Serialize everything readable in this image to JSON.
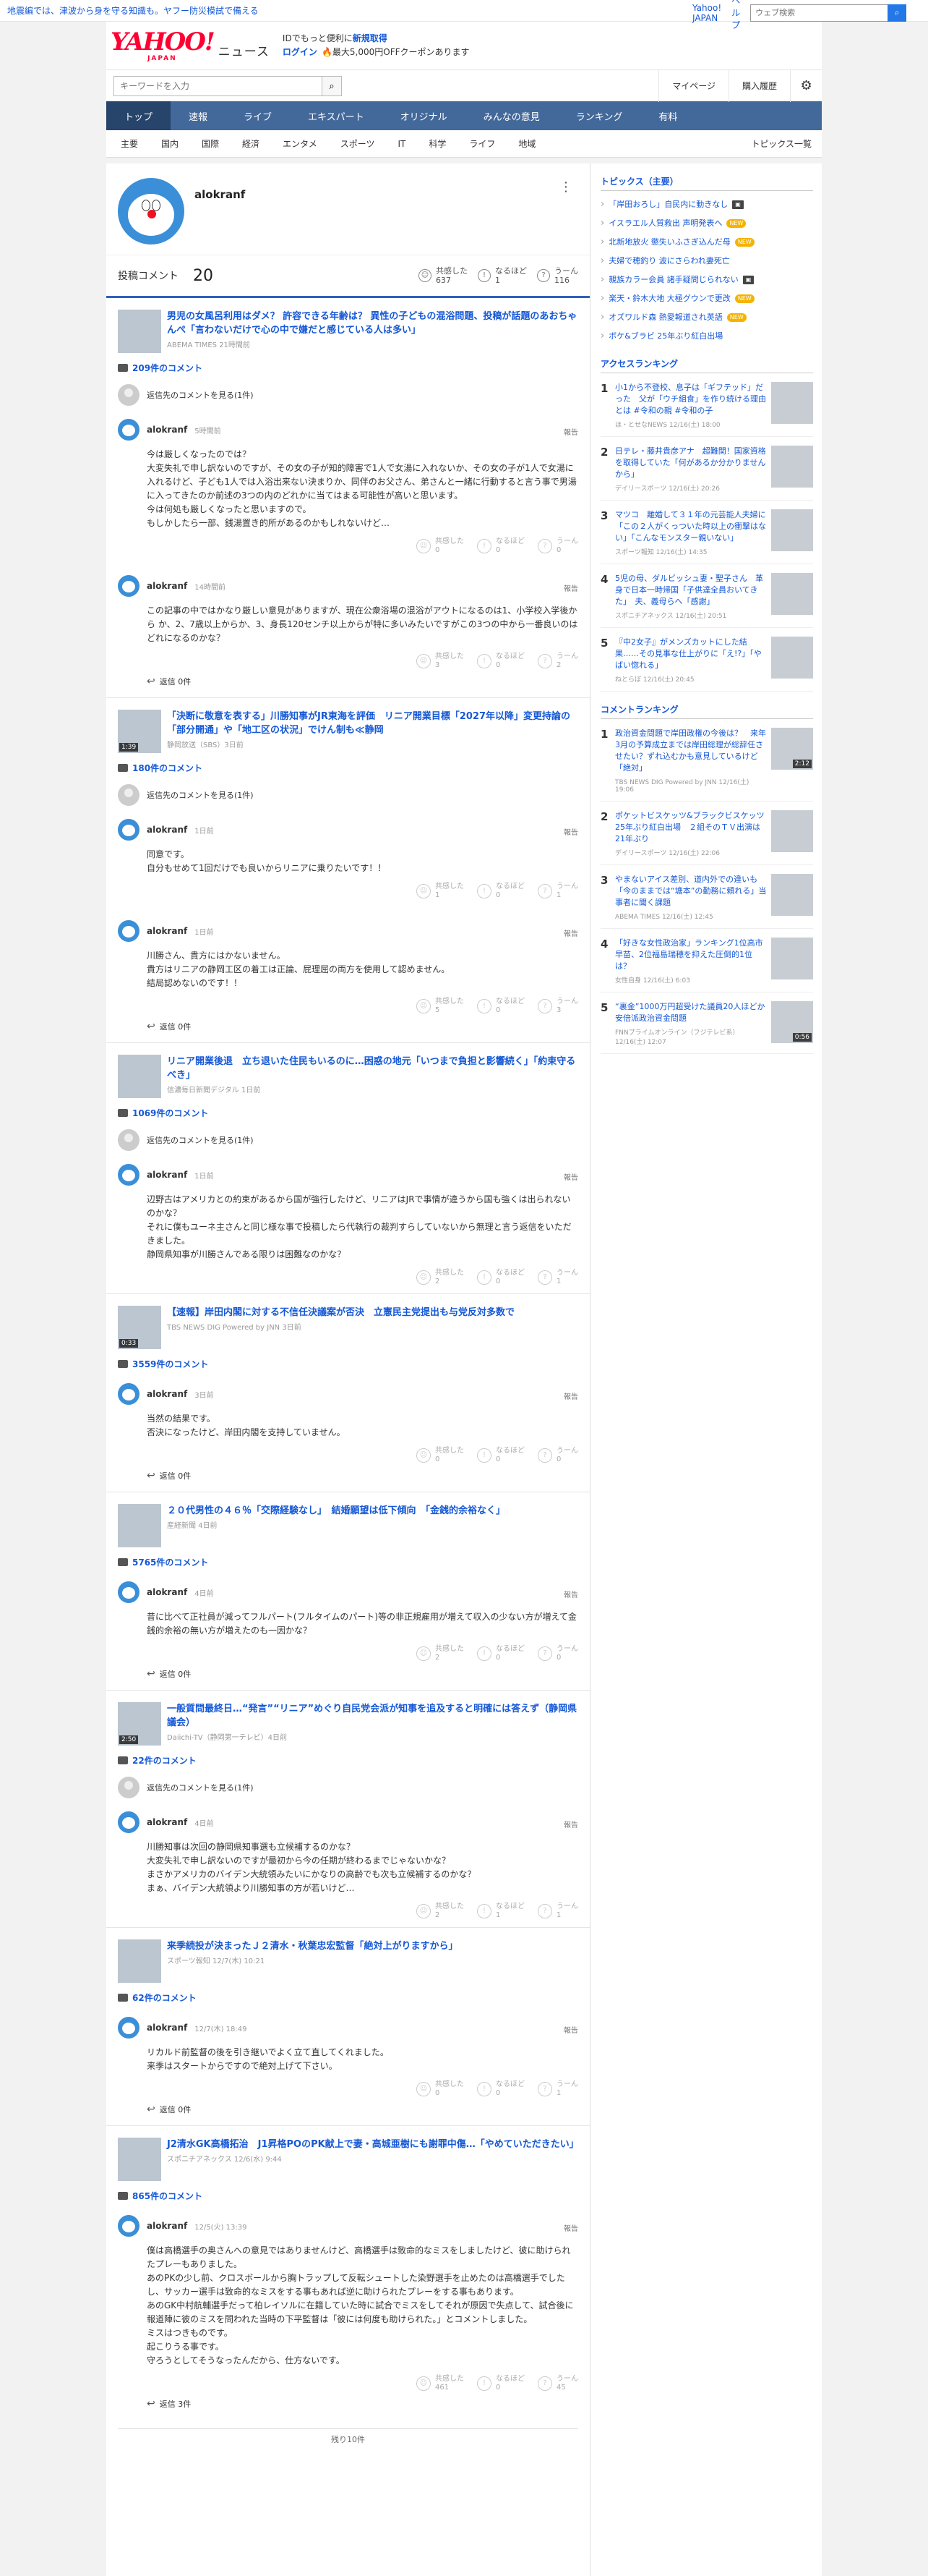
{
  "banner": {
    "message": "地震編では、津波から身を守る知識も。ヤフー防災模試で備える",
    "links": [
      "Yahoo! JAPAN",
      "ヘルプ"
    ],
    "search_placeholder": "ウェブ検索"
  },
  "header": {
    "logo_main": "YAHOO!",
    "logo_sub": "JAPAN",
    "logo_news": "ニュース",
    "promo_line1_prefix": "IDでもっと便利に",
    "promo_line1_link": "新規取得",
    "promo_login": "ログイン",
    "promo_coupon": "最大5,000円OFFクーポンあります"
  },
  "search_row": {
    "placeholder": "キーワードを入力",
    "links": [
      "マイページ",
      "購入履歴"
    ]
  },
  "main_nav": [
    "トップ",
    "速報",
    "ライブ",
    "エキスパート",
    "オリジナル",
    "みんなの意見",
    "ランキング",
    "有料"
  ],
  "sub_nav": [
    "主要",
    "国内",
    "国際",
    "経済",
    "エンタメ",
    "スポーツ",
    "IT",
    "科学",
    "ライフ",
    "地域"
  ],
  "sub_nav_right": "トピックス一覧",
  "profile": {
    "name": "alokranf",
    "comment_label": "投稿コメント",
    "comment_count": "20",
    "reactions": [
      {
        "label": "共感した",
        "value": "637"
      },
      {
        "label": "なるほど",
        "value": "1"
      },
      {
        "label": "うーん",
        "value": "116"
      }
    ]
  },
  "articles": [
    {
      "title": "男児の女風呂利用はダメ？ 許容できる年齢は？ 異性の子どもの混浴問題、投稿が話題のあおちゃんぺ「言わないだけで心の中で嫌だと感じている人は多い」",
      "source": "ABEMA TIMES 21時間前",
      "comment_count": "209件のコメント",
      "deleted": "返信先のコメントを見る(1件)",
      "comments": [
        {
          "user": "alokranf",
          "time": "5時間前",
          "body": "今は厳しくなったのでは？\n大変失礼で申し訳ないのですが、その女の子が知的障害で1人で女湯に入れないか、その女の子が1人で女湯に入れるけど、子ども1人では入浴出来ない決まりか、同伴のお父さん、弟さんと一緒に行動すると言う事で男湯に入ってきたのか前述の3つの内のどれかに当てはまる可能性が高いと思います。\n今は何処も厳しくなったと思いますので。\nもしかしたら一部、銭湯置き的所があるのかもしれないけど…",
          "r1": "0",
          "r2": "0",
          "r3": "0",
          "reply": ""
        },
        {
          "user": "alokranf",
          "time": "14時間前",
          "body": "この記事の中ではかなり厳しい意見がありますが、現在公衆浴場の混浴がアウトになるのは1、小学校入学後から か、2、7歳以上からか、3、身長120センチ以上からが特に多いみたいですがこの3つの中から一番良いのはどれになるのかな？",
          "r1": "3",
          "r2": "0",
          "r3": "2",
          "reply": "返信 0件"
        }
      ]
    },
    {
      "title": "「決断に敬意を表する」川勝知事がJR東海を評価　リニア開業目標「2027年以降」変更持論の「部分開通」や「地工区の状況」でけん制も≪静岡",
      "source": "静岡放送（SBS）3日前",
      "comment_count": "180件のコメント",
      "dur": "1:39",
      "deleted": "返信先のコメントを見る(1件)",
      "comments": [
        {
          "user": "alokranf",
          "time": "1日前",
          "body": "同意です。\n自分もせめて1回だけでも良いからリニアに乗りたいです！！",
          "r1": "1",
          "r2": "0",
          "r3": "1",
          "reply": ""
        },
        {
          "user": "alokranf",
          "time": "1日前",
          "body": "川勝さん、貴方にはかないません。\n貴方はリニアの静岡工区の着工は正論、屁理屈の両方を使用して認めません。\n結局認めないのです！！",
          "r1": "5",
          "r2": "0",
          "r3": "3",
          "reply": "返信 0件"
        }
      ]
    },
    {
      "title": "リニア開業後退　立ち退いた住民もいるのに…困惑の地元「いつまで負担と影響続く」「約束守るべき」",
      "source": "信濃毎日新聞デジタル 1日前",
      "comment_count": "1069件のコメント",
      "deleted": "返信先のコメントを見る(1件)",
      "comments": [
        {
          "user": "alokranf",
          "time": "1日前",
          "body": "辺野古はアメリカとの約束があるから国が強行したけど、リニアはJRで事情が違うから国も強くは出られないのかな？\nそれに僕もユーネ主さんと同じ様な事で投稿したら代執行の裁判すらしていないから無理と言う返信をいただきました。\n静岡県知事が川勝さんである限りは困難なのかな？",
          "r1": "2",
          "r2": "0",
          "r3": "1",
          "reply": ""
        }
      ]
    },
    {
      "title": "【速報】岸田内閣に対する不信任決議案が否決　立憲民主党提出も与党反対多数で",
      "source": "TBS NEWS DIG Powered by JNN 3日前",
      "comment_count": "3559件のコメント",
      "dur": "0:33",
      "comments": [
        {
          "user": "alokranf",
          "time": "3日前",
          "body": "当然の結果です。\n否決になったけど、岸田内閣を支持していません。",
          "r1": "0",
          "r2": "0",
          "r3": "0",
          "reply": "返信 0件"
        }
      ]
    },
    {
      "title": "２０代男性の４６％「交際経験なし」　結婚願望は低下傾向　「金銭的余裕なく」",
      "source": "産経新聞 4日前",
      "comment_count": "5765件のコメント",
      "comments": [
        {
          "user": "alokranf",
          "time": "4日前",
          "body": "昔に比べて正社員が減ってフルパート(フルタイムのパート)等の非正規雇用が増えて収入の少ない方が増えて金銭的余裕の無い方が増えたのも一因かな？",
          "r1": "2",
          "r2": "0",
          "r3": "0",
          "reply": "返信 0件"
        }
      ]
    },
    {
      "title": "一般質問最終日…“発言”“リニア”めぐり自民党会派が知事を追及すると明確には答えず（静岡県議会）",
      "source": "Daiichi-TV（静岡第一テレビ）4日前",
      "comment_count": "22件のコメント",
      "dur": "2:50",
      "deleted": "返信先のコメントを見る(1件)",
      "comments": [
        {
          "user": "alokranf",
          "time": "4日前",
          "body": "川勝知事は次回の静岡県知事選も立候補するのかな？\n大変失礼で申し訳ないのですが最初から今の任期が終わるまでじゃないかな？\nまさかアメリカのバイデン大統領みたいにかなりの高齢でも次も立候補するのかな？\nまぁ、バイデン大統領より川勝知事の方が若いけど…",
          "r1": "2",
          "r2": "1",
          "r3": "1",
          "reply": ""
        }
      ]
    },
    {
      "title": "来季続投が決まったＪ２清水・秋葉忠宏監督「絶対上がりますから」",
      "source": "スポーツ報知 12/7(木) 10:21",
      "comment_count": "62件のコメント",
      "comments": [
        {
          "user": "alokranf",
          "time": "12/7(木) 18:49",
          "body": "リカルド前監督の後を引き継いでよく立て直してくれました。\n来季はスタートからですので絶対上げて下さい。",
          "r1": "0",
          "r2": "0",
          "r3": "1",
          "reply": "返信 0件"
        }
      ]
    },
    {
      "title": "J2清水GK高橋拓治　J1昇格POのPK献上で妻・高城亜樹にも謝罪中傷…「やめていただきたい」",
      "source": "スポニチアネックス 12/6(水) 9:44",
      "comment_count": "865件のコメント",
      "comments": [
        {
          "user": "alokranf",
          "time": "12/5(火) 13:39",
          "body": "僕は高橋選手の奥さんへの意見ではありませんけど、高橋選手は致命的なミスをしましたけど、彼に助けられたプレーもありました。\nあのPKの少し前、クロスボールから胸トラップして反転シュートした染野選手を止めたのは高橋選手でしたし、サッカー選手は致命的なミスをする事もあれば逆に助けられたプレーをする事もあります。\nあのGK中村航輔選手だって柏レイソルに在籍していた時に試合でミスをしてそれが原因で失点して、試合後に報道陣に彼のミスを問われた当時の下平監督は「彼には何度も助けられた。」とコメントしました。\nミスはつきものです。\n起こりうる事です。\n守ろうとしてそうなったんだから、仕方ないです。",
          "r1": "461",
          "r2": "0",
          "r3": "45",
          "reply": "返信 3件"
        }
      ]
    }
  ],
  "remaining": "残り10件",
  "reaction_labels": [
    "共感した",
    "なるほど",
    "うーん"
  ],
  "report_label": "報告",
  "right": {
    "topics_head": "トピックス（主要）",
    "topics": [
      {
        "t": "「岸田おろし」自民内に動きなし",
        "b": "img"
      },
      {
        "t": "イスラエル人質救出 声明発表へ",
        "b": "new"
      },
      {
        "t": "北新地放火 懲失いふさぎ込んだ母",
        "b": "new"
      },
      {
        "t": "夫婦で穂釣り 波にさらわれ妻死亡",
        "b": ""
      },
      {
        "t": "親族カラー会員 諸手疑問じられない",
        "b": "img"
      },
      {
        "t": "楽天・鈴木大地 大極グウンで更改",
        "b": "new"
      },
      {
        "t": "オズワルド森 熱愛報道され英語",
        "b": "new"
      },
      {
        "t": "ボケ&ブラビ 25年ぶり紅白出場",
        "b": ""
      }
    ],
    "access_head": "アクセスランキング",
    "access": [
      {
        "t": "小1から不登校、息子は「ギフテッド」だった　父が「ウチ組食」を作り続ける理由とは #令和の親 #令和の子",
        "s": "ほ・とせなNEWS 12/16(土) 18:00"
      },
      {
        "t": "日テレ・藤井貴彦アナ　超難関！国家資格を取得していた「何があるか分かりませんから」",
        "s": "デイリースポーツ 12/16(土) 20:26"
      },
      {
        "t": "マツコ　離婚して３１年の元芸能人夫婦に「この２人がくっついた時以上の衝撃はない」「こんなモンスター親いない」",
        "s": "スポーツ報知 12/16(土) 14:35"
      },
      {
        "t": "5児の母、ダルビッシュ妻・聖子さん　革身で日本一時帰国「子供達全員おいてきた」　夫、義母らへ「感謝」",
        "s": "スポニチアネックス 12/16(土) 20:51"
      },
      {
        "t": "『中2女子』がメンズカットにした結果……その見事な仕上がりに「え!?」「やばい惚れる」",
        "s": "ねとらぼ 12/16(土) 20:45"
      }
    ],
    "comment_head": "コメントランキング",
    "comment_rank": [
      {
        "t": "政治資金問題で岸田政権の今後は？　来年3月の予算成立までは岸田総理が総辞任させたい？ずれ込むかも意見しているけど「絶対」",
        "s": "TBS NEWS DIG Powered by JNN 12/16(土) 19:06",
        "dur": "2:12"
      },
      {
        "t": "ポケットビスケッツ&ブラックビスケッツ25年ぶり紅白出場　２組そのＴＶ出演は21年ぶり",
        "s": "デイリースポーツ 12/16(土) 22:06"
      },
      {
        "t": "やまないアイス差別、道内外での違いも「今のままでは“塘本”の勤務に頼れる」当事者に聞く課題",
        "s": "ABEMA TIMES 12/16(土) 12:45"
      },
      {
        "t": "「好きな女性政治家」ランキング1位高市早苗、2位福島瑞穂を抑えた圧倒的1位は？",
        "s": "女性自身 12/16(土) 6:03"
      },
      {
        "t": "“裏金”1000万円超受けた議員20人ほどか　安倍派政治資金問題",
        "s": "FNNプライムオンライン（フジテレビ系）12/16(土) 12:07",
        "dur": "0:56"
      }
    ]
  }
}
